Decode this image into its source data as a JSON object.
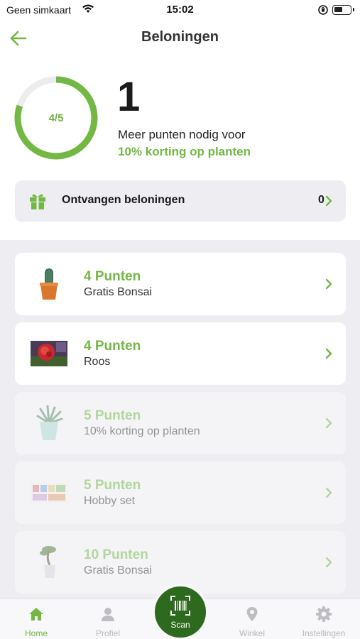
{
  "status_bar": {
    "carrier": "Geen simkaart",
    "time": "15:02"
  },
  "header": {
    "title": "Beloningen"
  },
  "progress": {
    "ring_label": "4/5",
    "current": 4,
    "max": 5,
    "count": "1",
    "text": "Meer punten nodig voor",
    "target": "10% korting op planten"
  },
  "received": {
    "label": "Ontvangen beloningen",
    "count": "0"
  },
  "rewards": [
    {
      "points": "4 Punten",
      "name": "Gratis Bonsai",
      "icon": "cactus-pot-image",
      "available": true
    },
    {
      "points": "4 Punten",
      "name": "Roos",
      "icon": "rose-photo",
      "available": true
    },
    {
      "points": "5 Punten",
      "name": "10% korting op planten",
      "icon": "succulent-pot-image",
      "available": false
    },
    {
      "points": "5 Punten",
      "name": "Hobby set",
      "icon": "hobby-set-image",
      "available": false
    },
    {
      "points": "10 Punten",
      "name": "Gratis Bonsai",
      "icon": "bonsai-pot-image",
      "available": false
    }
  ],
  "tabs": [
    {
      "label": "Home",
      "icon": "home-icon",
      "active": true
    },
    {
      "label": "Profiel",
      "icon": "person-icon",
      "active": false
    },
    {
      "label": "Scan",
      "icon": "barcode-scan-icon",
      "active": false
    },
    {
      "label": "Winkel",
      "icon": "location-pin-icon",
      "active": false
    },
    {
      "label": "Instellingen",
      "icon": "gear-icon",
      "active": false
    }
  ],
  "colors": {
    "accent": "#72b843",
    "scan_button": "#2e6a1d",
    "card_bg": "#eeeef2",
    "ring_track": "#ececef"
  }
}
